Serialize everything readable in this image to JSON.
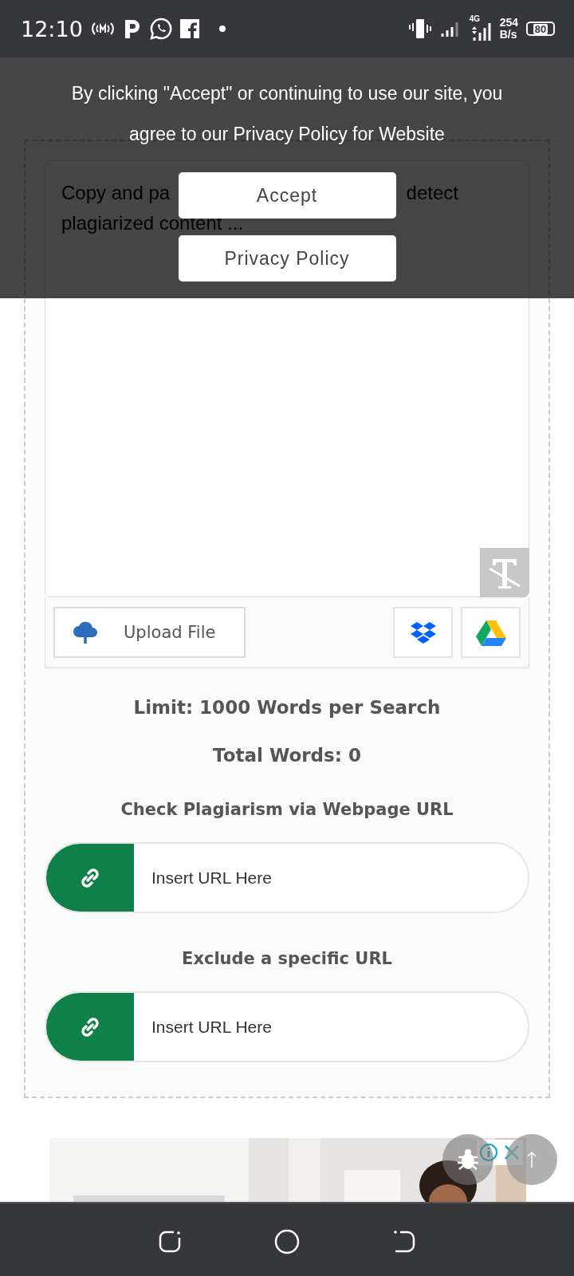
{
  "status_bar": {
    "time": "12:10",
    "network": "4G",
    "speed_value": "254",
    "speed_unit": "B/s",
    "battery": "80"
  },
  "editor": {
    "placeholder_start": "Copy and pa",
    "placeholder_end": "detect",
    "placeholder_line2": "plagiarized content ...",
    "upload_label": "Upload File"
  },
  "limit_text": "Limit: 1000 Words per Search",
  "total_words": "Total Words: 0",
  "url_sections": [
    {
      "heading": "Check Plagiarism via Webpage URL",
      "placeholder": "Insert URL Here"
    },
    {
      "heading": "Exclude a specific URL",
      "placeholder": "Insert URL Here"
    }
  ],
  "cookie_banner": {
    "message": "By clicking \"Accept\" or continuing to use our site, you agree to our Privacy Policy for Website",
    "buttons": [
      "Accept",
      "Privacy Policy"
    ]
  }
}
